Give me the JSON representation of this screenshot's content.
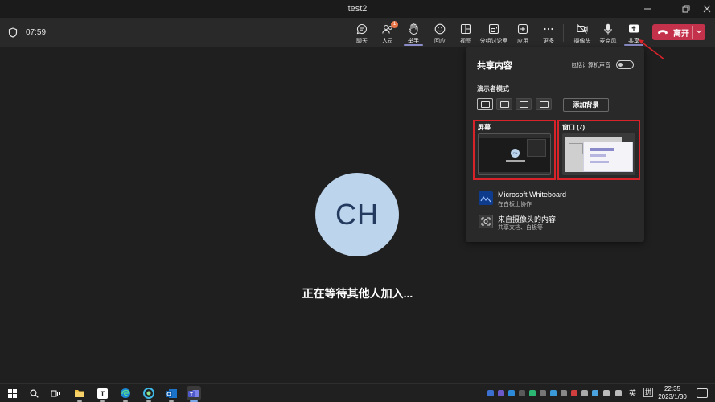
{
  "window": {
    "title": "test2"
  },
  "toolbar": {
    "timer": "07:59",
    "buttons": [
      {
        "label": "聊天",
        "icon": "chat-icon"
      },
      {
        "label": "人员",
        "icon": "people-icon",
        "badge": "1"
      },
      {
        "label": "举手",
        "icon": "raise-hand-icon"
      },
      {
        "label": "回应",
        "icon": "reactions-icon"
      },
      {
        "label": "视图",
        "icon": "view-icon"
      },
      {
        "label": "分组讨论室",
        "icon": "breakout-rooms-icon"
      },
      {
        "label": "应用",
        "icon": "apps-icon"
      },
      {
        "label": "更多",
        "icon": "more-icon"
      },
      {
        "label": "摄像头",
        "icon": "camera-off-icon"
      },
      {
        "label": "麦克风",
        "icon": "microphone-icon"
      },
      {
        "label": "共享",
        "icon": "share-icon"
      }
    ],
    "leave_label": "离开",
    "accent": "#c4314b"
  },
  "main": {
    "avatar_initials": "CH",
    "waiting_text": "正在等待其他人加入..."
  },
  "share_panel": {
    "title": "共享内容",
    "include_audio_label": "包括计算机声音",
    "presenter_mode_label": "演示者模式",
    "add_background_label": "添加背景",
    "screen_label": "屏幕",
    "window_label": "窗口 (7)",
    "screen_thumb_initials": "CH",
    "apps": [
      {
        "name": "Microsoft Whiteboard",
        "sub": "在白板上协作",
        "icon": "whiteboard-icon"
      },
      {
        "name": "来自摄像头的内容",
        "sub": "共享文档、白板等",
        "icon": "camera-content-icon"
      }
    ],
    "highlight_color": "#d9232a"
  },
  "taskbar": {
    "apps": [
      "windows-start-icon",
      "search-icon",
      "task-view-icon",
      "file-explorer-icon",
      "typora-icon",
      "edge-icon",
      "edge-beta-icon",
      "outlook-icon",
      "teams-icon"
    ],
    "ime_primary": "英",
    "ime_secondary": "拼",
    "time": "22:35",
    "date": "2023/1/30"
  }
}
